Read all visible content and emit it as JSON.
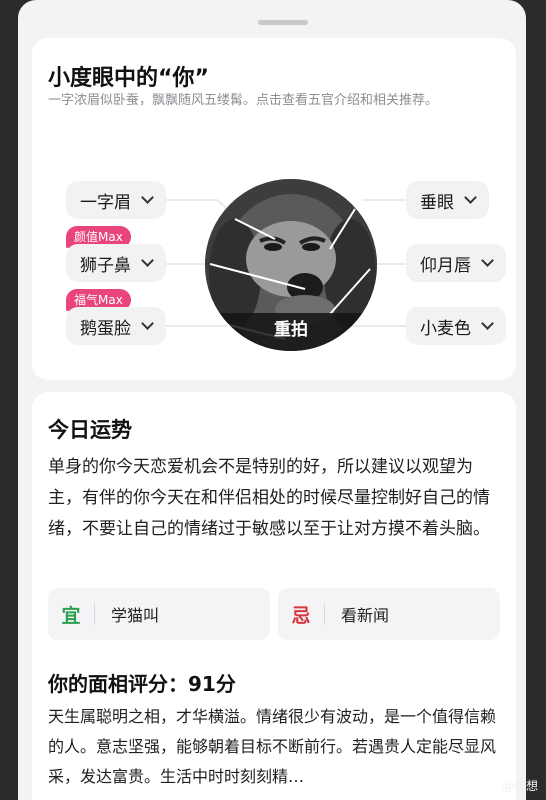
{
  "features_card": {
    "title": "小度眼中的“你”",
    "subtitle": "一字浓眉似卧蚕，飘飘随风五缕髯。点击查看五官介绍和相关推荐。",
    "left_features": [
      {
        "label": "一字眉",
        "tag": ""
      },
      {
        "label": "狮子鼻",
        "tag": "颜值Max"
      },
      {
        "label": "鹅蛋脸",
        "tag": "福气Max"
      }
    ],
    "right_features": [
      {
        "label": "垂眼"
      },
      {
        "label": "仰月唇"
      },
      {
        "label": "小麦色"
      }
    ],
    "retake_label": "重拍"
  },
  "fortune_card": {
    "title": "今日运势",
    "body": "单身的你今天恋爱机会不是特别的好，所以建议以观望为主，有伴的你今天在和伴侣相处的时候尽量控制好自己的情绪，不要让自己的情绪过于敏感以至于让对方摸不着头脑。",
    "do": {
      "glyph": "宜",
      "text": "学猫叫",
      "color": "#2e9e4f"
    },
    "dont": {
      "glyph": "忌",
      "text": "看新闻",
      "color": "#d9363e"
    },
    "score_title": "你的面相评分：91分",
    "score_body": "天生属聪明之相，才华横溢。情绪很少有波动，是一个值得信赖的人。意志坚强，能够朝着目标不断前行。若遇贵人定能尽显风采，发达富贵。生活中时时刻刻精…"
  },
  "watermark": "@哈想"
}
